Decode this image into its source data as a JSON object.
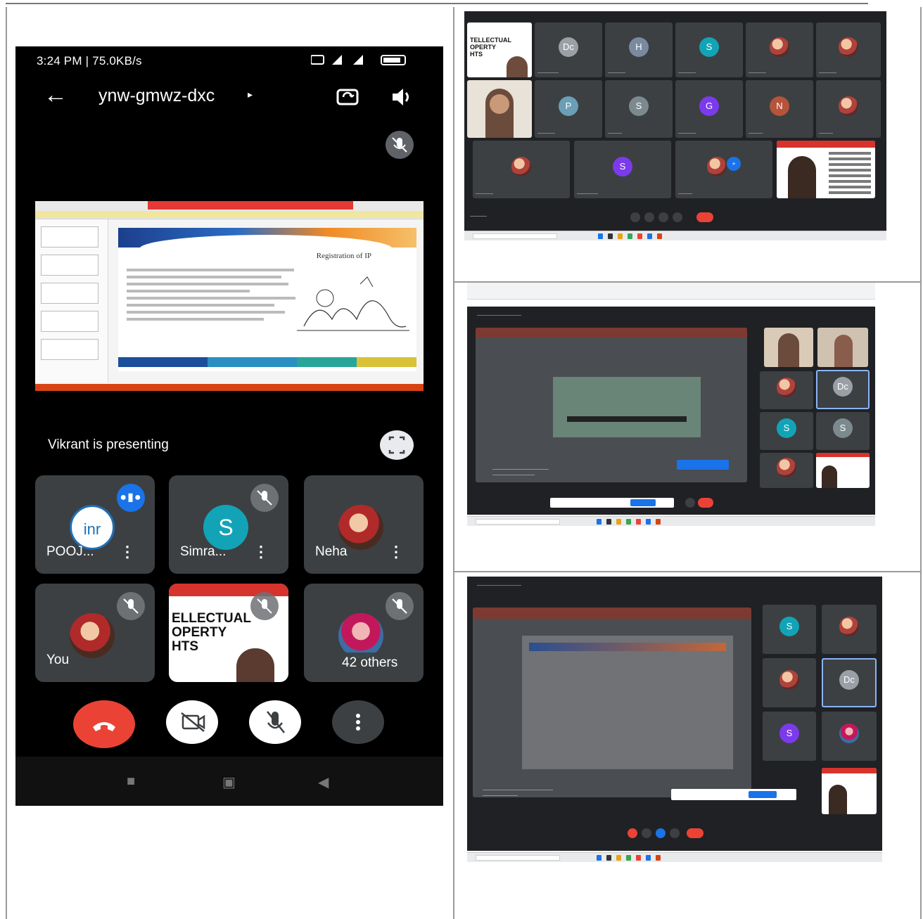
{
  "phone": {
    "status_bar": {
      "time_speed": "3:24 PM | 75.0KB/s",
      "system_icons": "alarm-icon signal-icon battery-icon"
    },
    "call": {
      "meeting_code": "ynw-gmwz-dxc",
      "caret": "▸"
    },
    "presentation": {
      "label": "Vikrant is presenting",
      "slide_title": "Registration of IP"
    },
    "participants": [
      {
        "name": "POOJ...",
        "avatar_text": "inr",
        "badge": "speaking"
      },
      {
        "name": "Simra...",
        "avatar_text": "S",
        "badge": "muted"
      },
      {
        "name": "Neha",
        "badge": "none"
      },
      {
        "name": "You",
        "badge": "muted"
      },
      {
        "name": "",
        "slide_text": "ELLECTUAL\nOPERTY\nHTS",
        "badge": "muted"
      },
      {
        "name": "",
        "more_count": "42 others",
        "badge": "muted"
      }
    ],
    "controls": [
      "end-call",
      "camera-off",
      "mic-off",
      "more"
    ]
  },
  "desktop_shots": {
    "shot1": {
      "tiles": 17
    },
    "shot2": {
      "tiles": 8
    },
    "shot3": {
      "tiles": 6
    }
  },
  "colors": {
    "meet_bg": "#202124",
    "tile_bg": "#3c4043",
    "end_call": "#ea4335",
    "accent_blue": "#1a73e8",
    "teal_avatar": "#12a4b6",
    "purple_avatar": "#7c3aed"
  }
}
